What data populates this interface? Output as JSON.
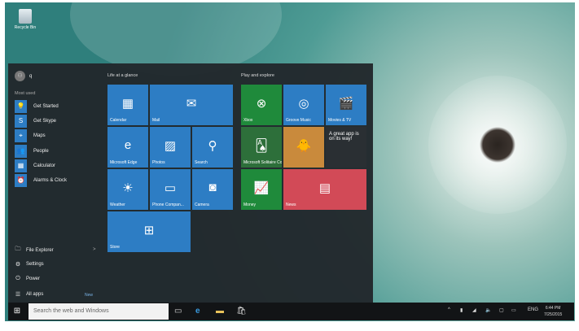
{
  "desktop": {
    "recycle_bin": "Recycle Bin"
  },
  "start": {
    "user": "q",
    "most_used_label": "Most used",
    "apps": [
      {
        "label": "Get Started",
        "icon": "lightbulb-icon",
        "glyph": "💡"
      },
      {
        "label": "Get Skype",
        "icon": "skype-icon",
        "glyph": "S"
      },
      {
        "label": "Maps",
        "icon": "maps-icon",
        "glyph": "⌖"
      },
      {
        "label": "People",
        "icon": "people-icon",
        "glyph": "👥"
      },
      {
        "label": "Calculator",
        "icon": "calculator-icon",
        "glyph": "▦"
      },
      {
        "label": "Alarms & Clock",
        "icon": "alarm-icon",
        "glyph": "⏰"
      }
    ],
    "bottom": [
      {
        "label": "File Explorer",
        "glyph": "🗀"
      },
      {
        "label": "Settings",
        "glyph": "⚙"
      },
      {
        "label": "Power",
        "glyph": "⏻"
      },
      {
        "label": "All apps",
        "glyph": "☰"
      }
    ],
    "new_badge": "New",
    "chevron": ">",
    "group1": "Life at a glance",
    "group2": "Play and explore",
    "tiles": {
      "calendar": "Calendar",
      "mail": "Mail",
      "edge": "Microsoft Edge",
      "photos": "Photos",
      "search": "Search",
      "weather": "Weather",
      "phone": "Phone Compan...",
      "camera": "Camera",
      "store": "Store",
      "xbox": "Xbox",
      "groove": "Groove Music",
      "movies": "Movies & TV",
      "solitaire": "Microsoft Solitaire Collection",
      "app_coming": "A great app is on its way!",
      "money": "Money",
      "news": "News"
    }
  },
  "taskbar": {
    "search_placeholder": "Search the web and Windows",
    "language": "ENG",
    "time": "6:44 PM",
    "date": "7/25/2015"
  },
  "colors": {
    "tile_blue": "#2d7dc4",
    "xbox_green": "#1f8a3b",
    "news_red": "#d24a57",
    "money_green": "#1f8a3b"
  }
}
